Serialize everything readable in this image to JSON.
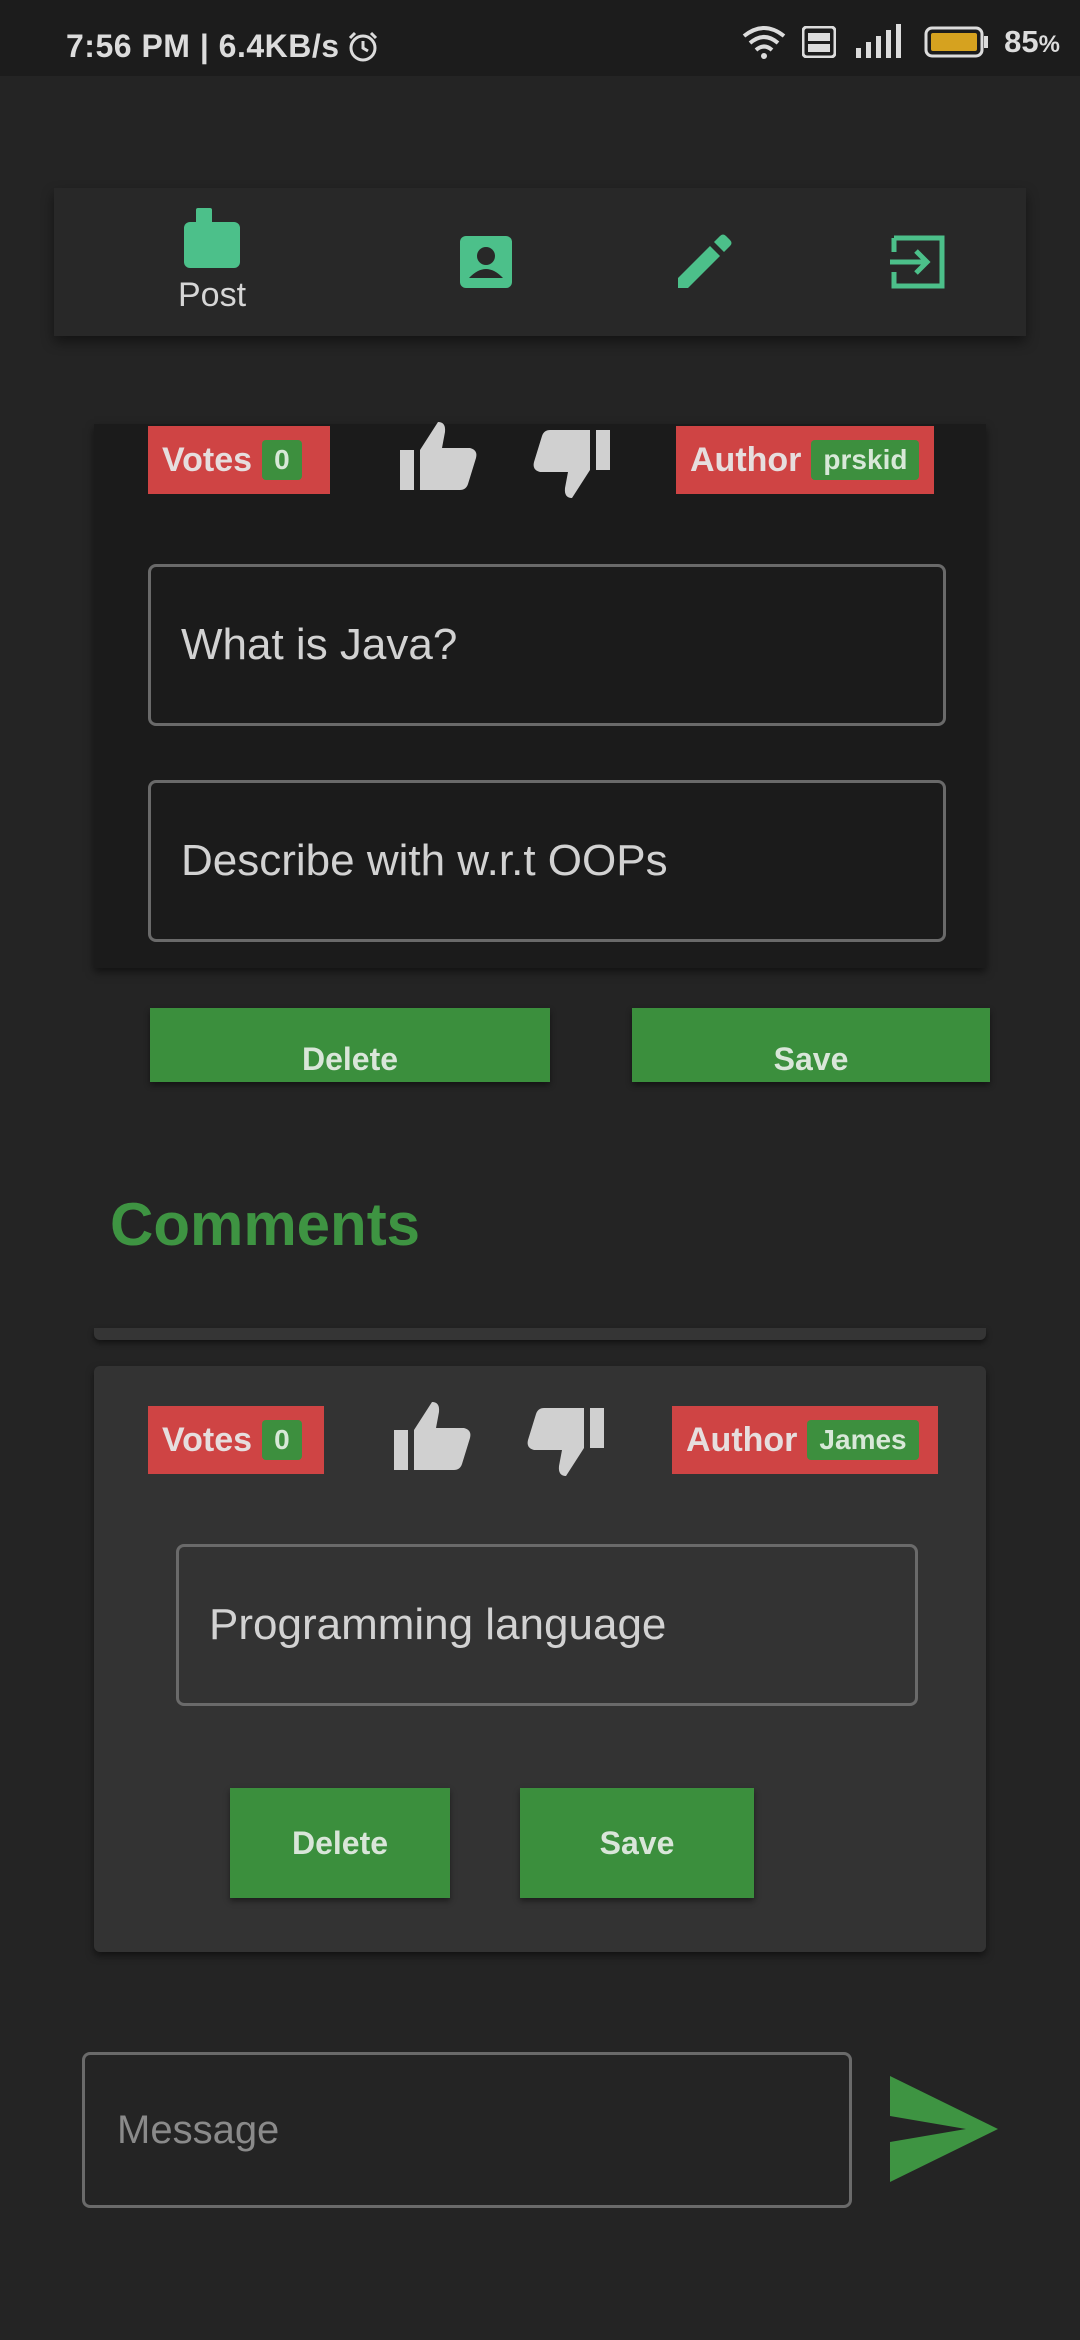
{
  "status_bar": {
    "time": "7:56 PM | 6.4KB/s",
    "battery_percent": "85",
    "battery_unit": "%",
    "icons": [
      "alarm-icon",
      "wifi-icon",
      "volte-icon",
      "4g-signal-icon",
      "battery-icon"
    ]
  },
  "nav": {
    "items": [
      {
        "label": "Post",
        "icon": "post-icon"
      },
      {
        "label": "",
        "icon": "profile-icon"
      },
      {
        "label": "",
        "icon": "edit-icon"
      },
      {
        "label": "",
        "icon": "logout-icon"
      }
    ]
  },
  "post": {
    "votes_label": "Votes",
    "votes_count": "0",
    "author_label": "Author",
    "author_name": "prskid",
    "title_value": "What is Java?",
    "body_value": "Describe with w.r.t OOPs",
    "delete_label": "Delete",
    "save_label": "Save"
  },
  "comments_heading": "Comments",
  "comments": [
    {
      "votes_label": "Votes",
      "votes_count": "0",
      "author_label": "Author",
      "author_name": "James",
      "text_value": "Programming language",
      "delete_label": "Delete",
      "save_label": "Save"
    }
  ],
  "message_input": {
    "placeholder": "Message"
  },
  "colors": {
    "accent_green": "#3b8f3d",
    "nav_icon_teal": "#4cc08a",
    "badge_red": "#cf4444",
    "background": "#242424"
  }
}
